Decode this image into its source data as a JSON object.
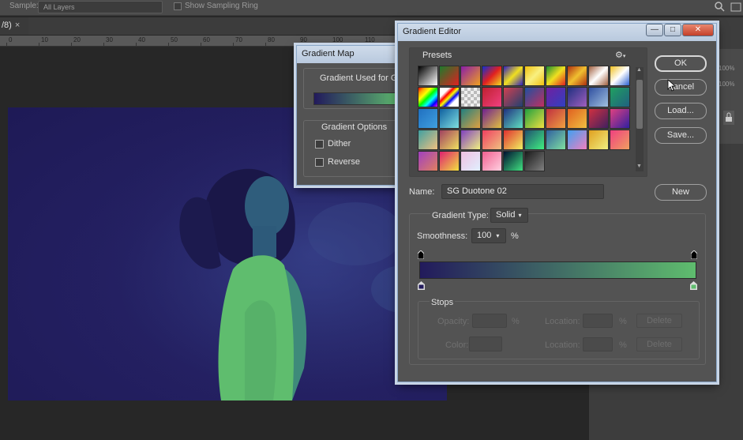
{
  "options_bar": {
    "sample_label": "Sample:",
    "sample_value": "All Layers",
    "sampling_ring_label": "Show Sampling Ring"
  },
  "document_tab": {
    "label": "/8)",
    "close": "×"
  },
  "ruler": {
    "ticks": [
      "0",
      "10",
      "20",
      "30",
      "40",
      "50",
      "60",
      "70",
      "80",
      "90",
      "100",
      "110"
    ]
  },
  "right_panel": {
    "values": [
      "100%",
      "100%"
    ]
  },
  "gradient_map": {
    "title": "Gradient Map",
    "gradient_used_label": "Gradient Used for G",
    "options_label": "Gradient Options",
    "dither_label": "Dither",
    "reverse_label": "Reverse",
    "colors": {
      "start": "#221a5c",
      "end": "#5fbd6e"
    }
  },
  "gradient_editor": {
    "title": "Gradient Editor",
    "window_buttons": {
      "minimize": "—",
      "maximize": "□",
      "close": "✕"
    },
    "presets_label": "Presets",
    "ok_label": "OK",
    "cancel_label": "Cancel",
    "load_label": "Load...",
    "save_label": "Save...",
    "name_label": "Name:",
    "name_value": "SG Duotone 02",
    "new_label": "New",
    "type_label": "Gradient Type:",
    "type_value": "Solid",
    "smoothness_label": "Smoothness:",
    "smoothness_value": "100",
    "smoothness_unit": "%",
    "gradient_colors": {
      "start": "#221a5c",
      "end": "#5fbd6e"
    },
    "stops": {
      "label": "Stops",
      "opacity_label": "Opacity:",
      "color_label": "Color:",
      "location_label": "Location:",
      "percent": "%",
      "delete_label": "Delete"
    },
    "preset_swatches": [
      "linear-gradient(135deg,#000,#fff)",
      "linear-gradient(135deg,#1d7a2c,#e02020)",
      "linear-gradient(135deg,#8a1ea8,#f0a020)",
      "linear-gradient(135deg,#1030d0,#e02020,#f0e020)",
      "linear-gradient(135deg,#3020c0,#f0e020,#3020c0)",
      "linear-gradient(135deg,#f0c010,#f8f080,#f0c010)",
      "linear-gradient(135deg,#1a8c30,#f0e020,#e02020)",
      "linear-gradient(135deg,#b03010,#f0c030,#b03010)",
      "linear-gradient(135deg,#a06040,#fff,#a06040)",
      "linear-gradient(135deg,#f0c020,#fff,#2a60d0)",
      "linear-gradient(135deg,red,orange,yellow,lime,cyan,blue,magenta)",
      "linear-gradient(135deg,#fff 25%,red,yellow,blue,#fff 75%)",
      "repeating-conic-gradient(#bbb 0% 25%,#eee 0% 50%) 0 0/8px 8px",
      "linear-gradient(135deg,#c02030,#f04080)",
      "linear-gradient(135deg,#d04050,#204070)",
      "linear-gradient(135deg,#2050a0,#c03060)",
      "linear-gradient(135deg,#7020a0,#3040c0)",
      "linear-gradient(135deg,#203080,#a060c0)",
      "linear-gradient(135deg,#3050a0,#a0c0e0)",
      "linear-gradient(135deg,#20a060,#206080)",
      "linear-gradient(135deg,#2070c0,#40a0e0)",
      "linear-gradient(135deg,#1060a0,#80e0e0)",
      "linear-gradient(135deg,#208080,#e0a040)",
      "linear-gradient(135deg,#702090,#e0c040)",
      "linear-gradient(135deg,#203080,#60e0c0)",
      "linear-gradient(135deg,#20a040,#f0e040)",
      "linear-gradient(135deg,#c03040,#f0a040)",
      "linear-gradient(135deg,#e06020,#f0c040)",
      "linear-gradient(135deg,#d03040,#402060)",
      "linear-gradient(135deg,#e04080,#3020a0)",
      "linear-gradient(135deg,#40a0a0,#f0c080)",
      "linear-gradient(135deg,#a04060,#f0e060)",
      "linear-gradient(135deg,#8040c0,#f0f080)",
      "linear-gradient(135deg,#f04060,#f0c080)",
      "linear-gradient(135deg,#e03030,#f0f060)",
      "linear-gradient(135deg,#205070,#40f080)",
      "linear-gradient(135deg,#3060a0,#80e0a0)",
      "linear-gradient(135deg,#40a0f0,#f080c0)",
      "linear-gradient(135deg,#e0a020,#f0f080)",
      "linear-gradient(135deg,#f04080,#f0a060)",
      "linear-gradient(135deg,#a040c0,#e08060)",
      "linear-gradient(135deg,#e02070,#f0e040)",
      "linear-gradient(135deg,#f0c0e0,#e0f0ff)",
      "linear-gradient(135deg,#f06090,#ffd0e0)",
      "linear-gradient(135deg,#001030,#40e080)",
      "linear-gradient(135deg,#1a1a1a,#808080)"
    ]
  }
}
